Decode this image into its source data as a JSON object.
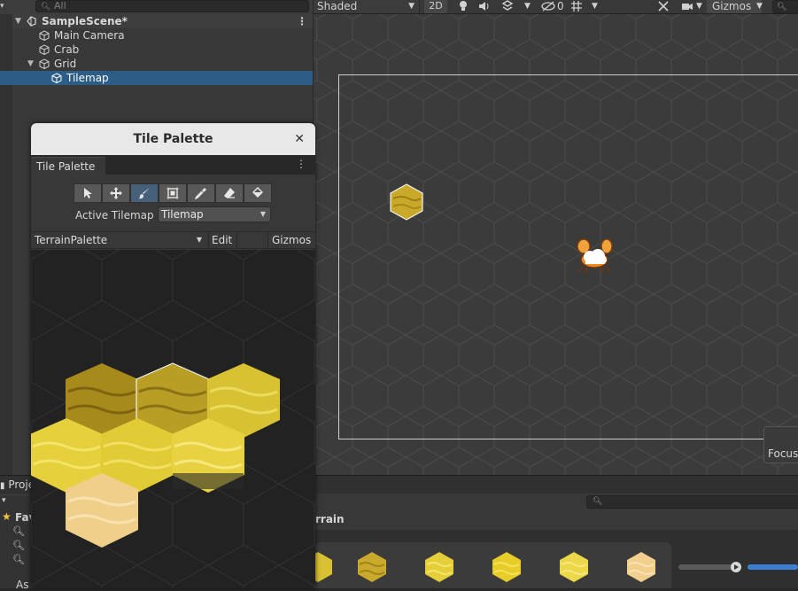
{
  "hierarchy": {
    "search_placeholder": "All",
    "scene": "SampleScene*",
    "items": [
      {
        "label": "Main Camera",
        "depth": 1
      },
      {
        "label": "Crab",
        "depth": 1
      },
      {
        "label": "Grid",
        "depth": 1
      },
      {
        "label": "Tilemap",
        "depth": 2
      }
    ],
    "selected": "Tilemap"
  },
  "scene_toolbar": {
    "shading": "Shaded",
    "mode_2d": "2D",
    "hidden_count": "0",
    "gizmos": "Gizmos"
  },
  "scene": {
    "focus_button": "Focus"
  },
  "tile_palette": {
    "window_title": "Tile Palette",
    "tab": "Tile Palette",
    "tools": [
      "select",
      "move",
      "paint",
      "box-fill",
      "picker",
      "erase",
      "flood-fill"
    ],
    "active_tool": "paint",
    "active_tilemap_label": "Active Tilemap",
    "active_tilemap": "Tilemap",
    "palette": "TerrainPalette",
    "edit": "Edit",
    "gizmos": "Gizmos"
  },
  "project": {
    "tab": "Proje",
    "favorites": "Fav",
    "breadcrumb": "rrain",
    "bottom_left": "As"
  },
  "colors": {
    "selection": "#2c5d87",
    "tile_dark": "#a88a1c",
    "tile_olive": "#b89e24",
    "tile_gold": "#d8c233",
    "tile_yellow": "#e6d03c",
    "tile_sand": "#f0cf8a"
  }
}
